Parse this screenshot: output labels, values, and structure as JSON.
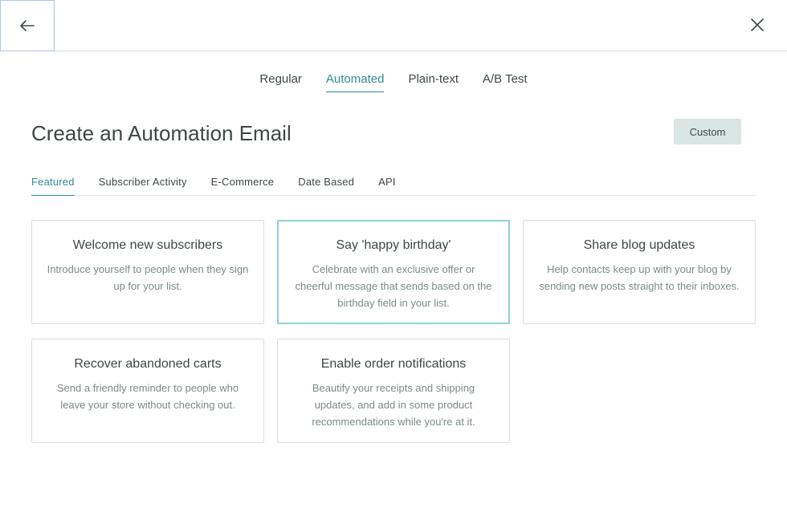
{
  "header": {
    "back_icon": "arrow-left-icon",
    "close_icon": "close-icon"
  },
  "type_tabs": [
    {
      "label": "Regular",
      "active": false
    },
    {
      "label": "Automated",
      "active": true
    },
    {
      "label": "Plain-text",
      "active": false
    },
    {
      "label": "A/B Test",
      "active": false
    }
  ],
  "page": {
    "title": "Create an Automation Email",
    "custom_label": "Custom"
  },
  "category_tabs": [
    {
      "label": "Featured",
      "active": true
    },
    {
      "label": "Subscriber Activity",
      "active": false
    },
    {
      "label": "E-Commerce",
      "active": false
    },
    {
      "label": "Date Based",
      "active": false
    },
    {
      "label": "API",
      "active": false
    }
  ],
  "cards": [
    {
      "title": "Welcome new subscribers",
      "description": "Introduce yourself to people when they sign up for your list."
    },
    {
      "title": "Say 'happy birthday'",
      "description": "Celebrate with an exclusive offer or cheerful message that sends based on the birthday field in your list.",
      "selected": true
    },
    {
      "title": "Share blog updates",
      "description": "Help contacts keep up with your blog by sending new posts straight to their inboxes."
    },
    {
      "title": "Recover abandoned carts",
      "description": "Send a friendly reminder to people who leave your store without checking out."
    },
    {
      "title": "Enable order notifications",
      "description": "Beautify your receipts and shipping updates, and add in some product recommendations while you're at it."
    }
  ],
  "colors": {
    "accent": "#2f8c95",
    "selected_border": "#8fd1d9",
    "custom_button_bg": "#d9e6e3"
  }
}
